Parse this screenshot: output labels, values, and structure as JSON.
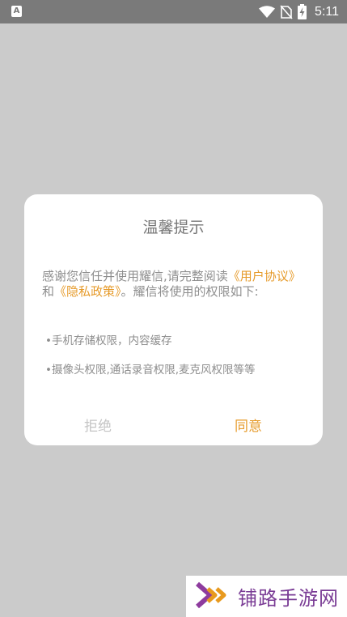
{
  "status_bar": {
    "left_icon": "A",
    "time": "5:11",
    "icons": [
      "wifi-icon",
      "no-sim-icon",
      "battery-charging-icon"
    ]
  },
  "dialog": {
    "title": "温馨提示",
    "body_prefix": "感谢您信任并使用耀信,请完整阅读",
    "user_agreement_link": "《用户协议》",
    "body_and": "和",
    "privacy_policy_link": "《隐私政策》",
    "body_suffix": "。耀信将使用的权限如下:",
    "permissions": [
      "•手机存储权限，内容缓存",
      "•摄像头权限,通话录音权限,麦克风权限等等"
    ],
    "refuse_label": "拒绝",
    "agree_label": "同意"
  },
  "watermark": {
    "text": "铺路手游网"
  },
  "colors": {
    "overlay": "#cbcbcb",
    "status_bar": "#7a7a7a",
    "accent": "#e69b2b",
    "watermark_purple": "#7a3c95"
  }
}
